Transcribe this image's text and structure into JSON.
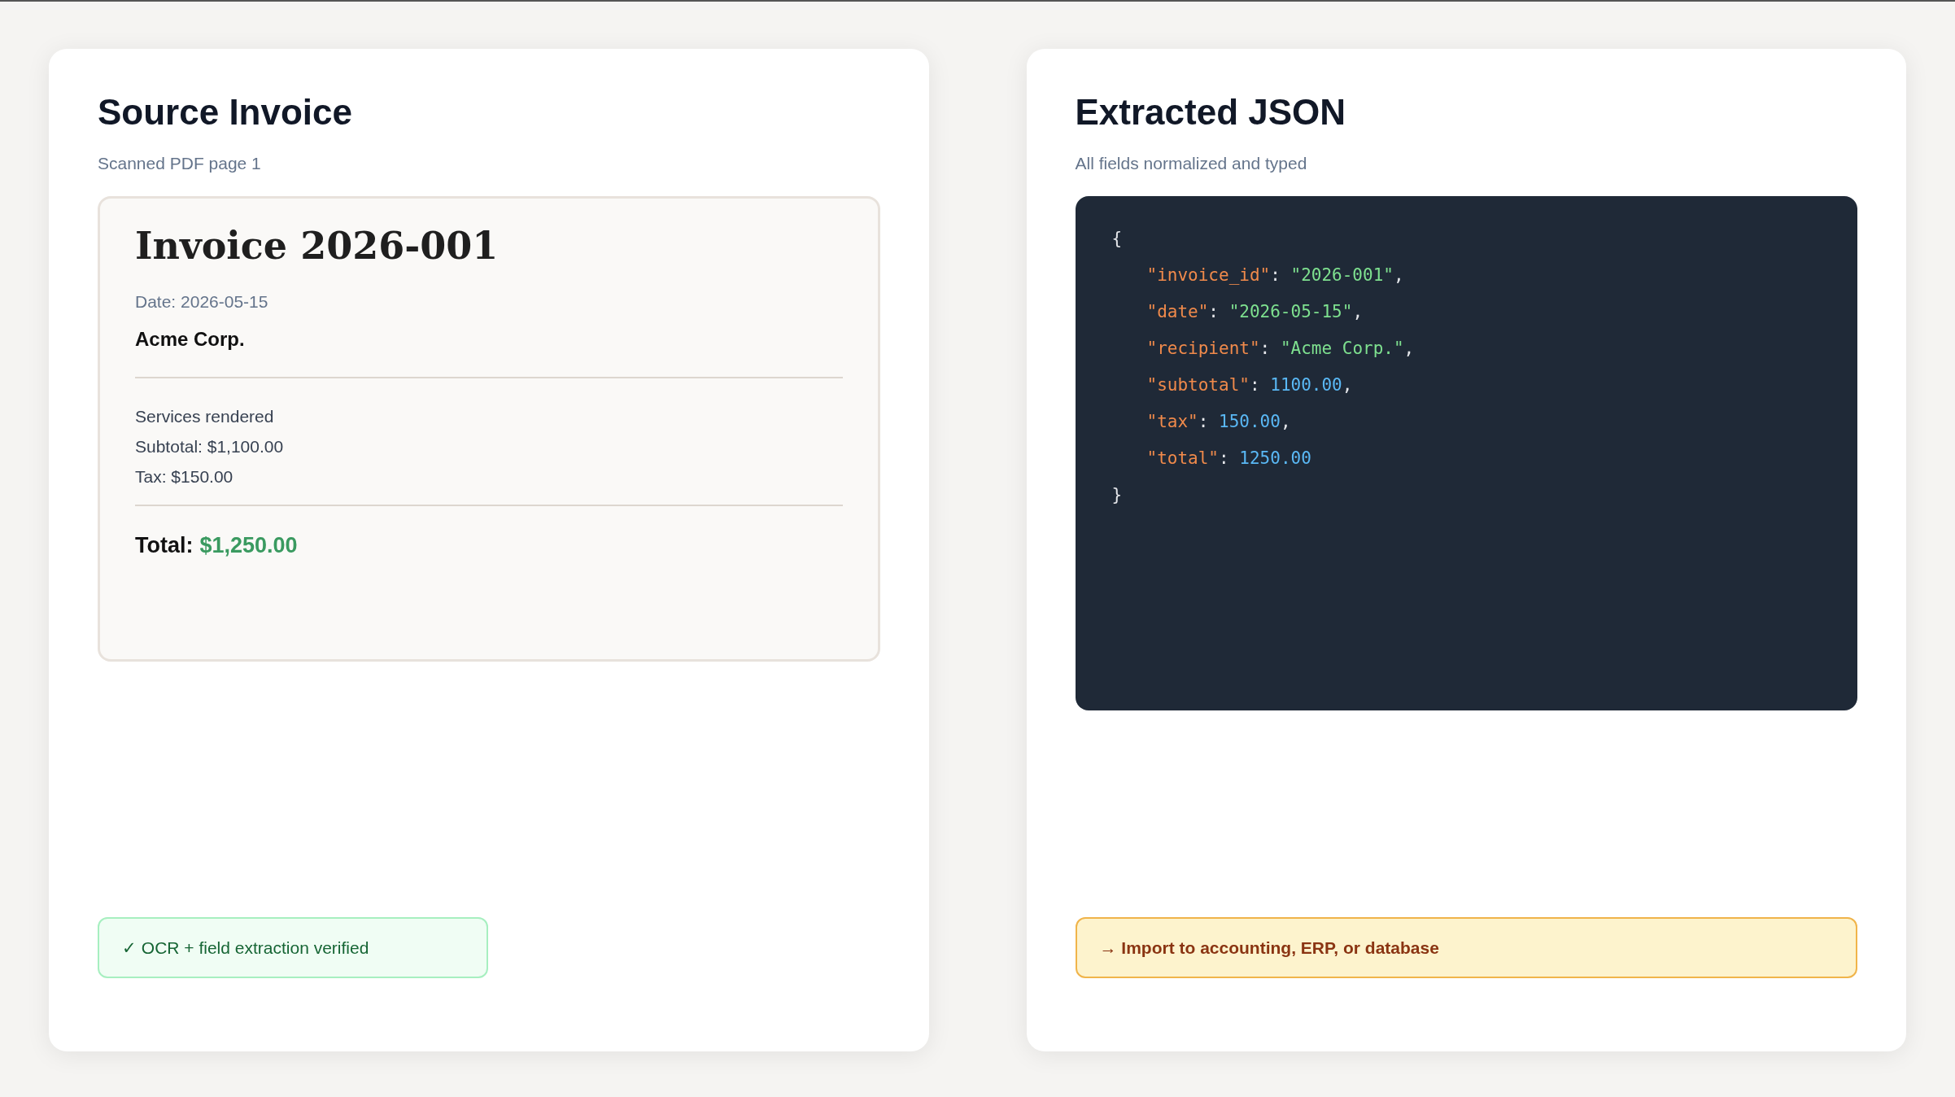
{
  "panels": [
    {
      "kind": "invoice",
      "title": "Source Invoice",
      "subtitle": "Scanned PDF page 1",
      "document": {
        "heading": "Invoice 2026-001",
        "date": "Date: 2026-05-15",
        "recipient": "Acme Corp.",
        "lines": [
          "Services rendered",
          "Subtotal: $1,100.00",
          "Tax: $150.00"
        ],
        "total_label": "Total:",
        "total_value": "$1,250.00"
      },
      "note": {
        "kind": "success",
        "text": "✓ OCR + field extraction verified"
      }
    },
    {
      "kind": "code",
      "title": "Extracted JSON",
      "subtitle": "All fields normalized and typed",
      "code_lines": [
        [
          {
            "text": "{",
            "kind": "punct"
          }
        ],
        [
          {
            "text": "\"invoice_id\"",
            "kind": "key"
          },
          {
            "text": ": ",
            "kind": "punct"
          },
          {
            "text": "\"2026-001\"",
            "kind": "string"
          },
          {
            "text": ",",
            "kind": "punct"
          }
        ],
        [
          {
            "text": "\"date\"",
            "kind": "key"
          },
          {
            "text": ": ",
            "kind": "punct"
          },
          {
            "text": "\"2026-05-15\"",
            "kind": "string"
          },
          {
            "text": ",",
            "kind": "punct"
          }
        ],
        [
          {
            "text": "\"recipient\"",
            "kind": "key"
          },
          {
            "text": ": ",
            "kind": "punct"
          },
          {
            "text": "\"Acme Corp.\"",
            "kind": "string"
          },
          {
            "text": ",",
            "kind": "punct"
          }
        ],
        [
          {
            "text": "\"subtotal\"",
            "kind": "key"
          },
          {
            "text": ": ",
            "kind": "punct"
          },
          {
            "text": "1100.00",
            "kind": "number"
          },
          {
            "text": ",",
            "kind": "punct"
          }
        ],
        [
          {
            "text": "\"tax\"",
            "kind": "key"
          },
          {
            "text": ": ",
            "kind": "punct"
          },
          {
            "text": "150.00",
            "kind": "number"
          },
          {
            "text": ",",
            "kind": "punct"
          }
        ],
        [
          {
            "text": "\"total\"",
            "kind": "key"
          },
          {
            "text": ": ",
            "kind": "punct"
          },
          {
            "text": "1250.00",
            "kind": "number"
          }
        ],
        [
          {
            "text": "}",
            "kind": "punct"
          }
        ]
      ],
      "note": {
        "kind": "warning",
        "text": "→ Import to accounting, ERP, or database"
      }
    }
  ]
}
